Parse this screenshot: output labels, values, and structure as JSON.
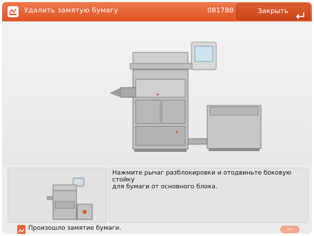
{
  "header": {
    "title": "Удалить замятую бумагу",
    "job_id": "081788",
    "close_label": "Закрыть",
    "accent": "#e8643a"
  },
  "instruction": {
    "text": "Нажмите рычаг разблокировки и отодвиньте боковую стойку\nдля бумаги от основного блока."
  },
  "status": {
    "message": "Произошло замятие бумаги.",
    "pill_label": "»»"
  },
  "icons": {
    "header": "paper-jam-icon",
    "close": "return-arrow-icon",
    "status": "paper-jam-icon"
  }
}
